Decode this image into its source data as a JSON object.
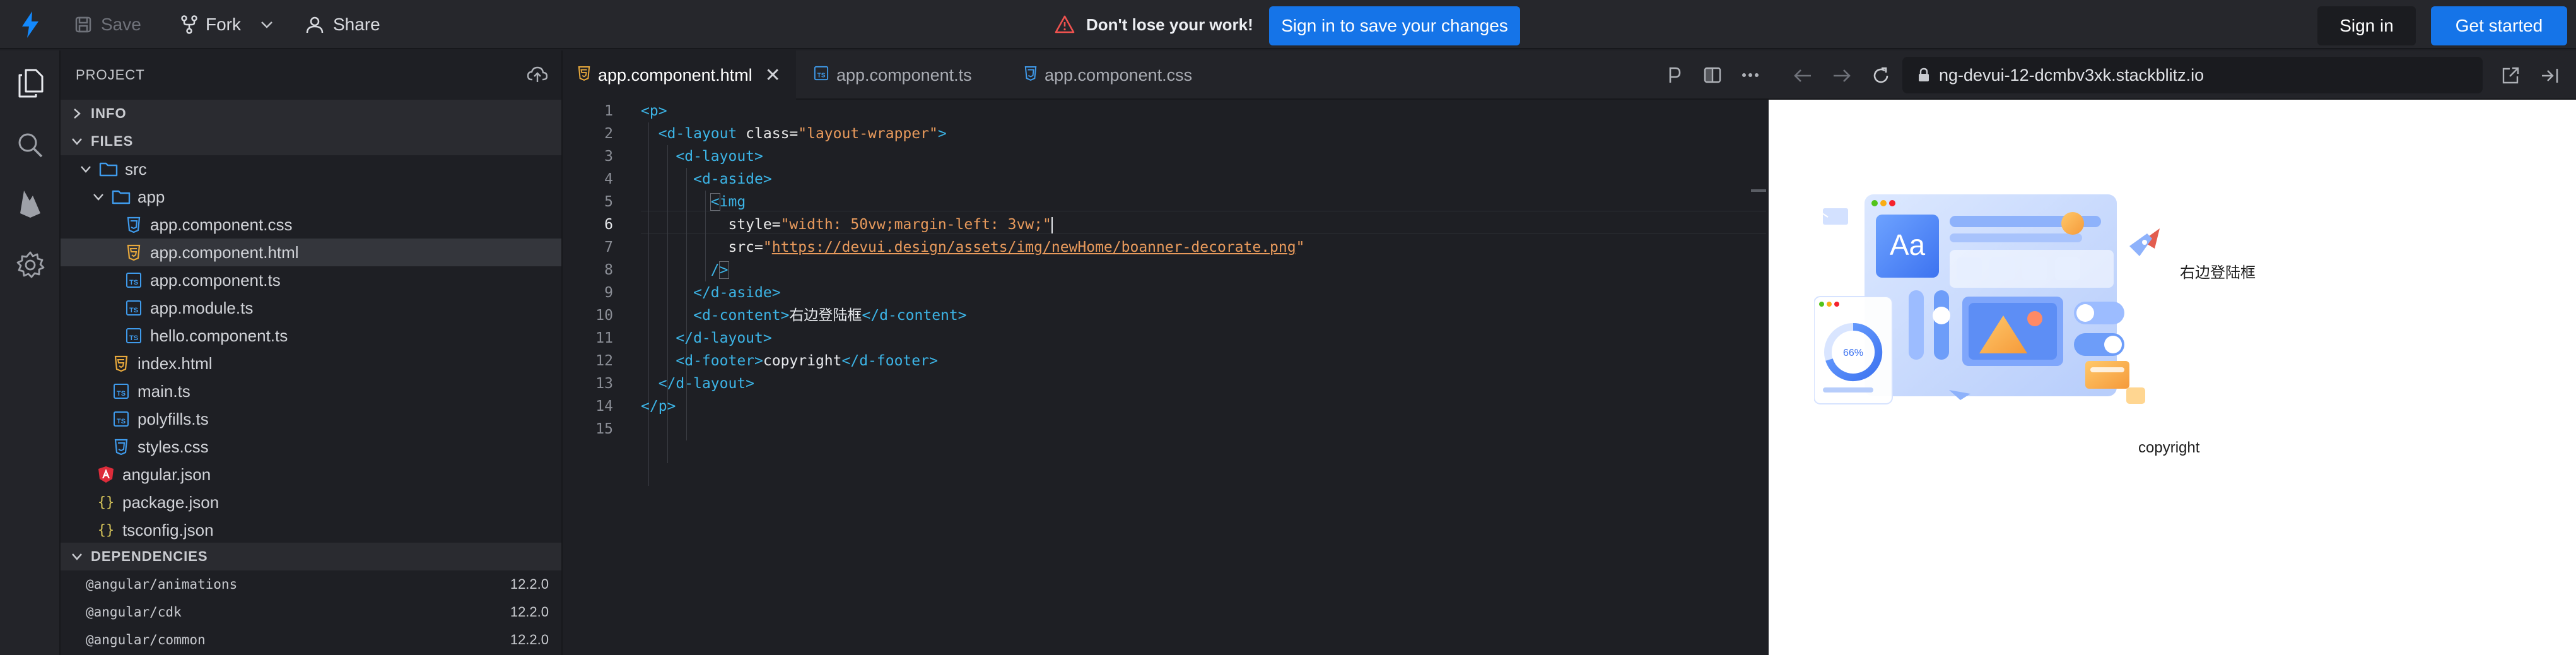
{
  "toolbar": {
    "save_label": "Save",
    "fork_label": "Fork",
    "share_label": "Share",
    "warning_text": "Don't lose your work!",
    "sign_in_save_label": "Sign in to save your changes",
    "sign_in_label": "Sign in",
    "get_started_label": "Get started",
    "accent_color": "#1574e8"
  },
  "sidebar": {
    "header": "PROJECT",
    "sections": {
      "info": "INFO",
      "files": "FILES",
      "dependencies": "DEPENDENCIES"
    },
    "files": [
      {
        "name": "src",
        "type": "folder",
        "icon": "folder-icon"
      },
      {
        "name": "app",
        "type": "folder",
        "icon": "folder-icon"
      },
      {
        "name": "app.component.css",
        "type": "css",
        "icon": "css-file-icon"
      },
      {
        "name": "app.component.html",
        "type": "html",
        "icon": "html-file-icon",
        "selected": true
      },
      {
        "name": "app.component.ts",
        "type": "ts",
        "icon": "ts-file-icon"
      },
      {
        "name": "app.module.ts",
        "type": "ts",
        "icon": "ts-file-icon"
      },
      {
        "name": "hello.component.ts",
        "type": "ts",
        "icon": "ts-file-icon"
      },
      {
        "name": "index.html",
        "type": "html",
        "icon": "html-file-icon"
      },
      {
        "name": "main.ts",
        "type": "ts",
        "icon": "ts-file-icon"
      },
      {
        "name": "polyfills.ts",
        "type": "ts",
        "icon": "ts-file-icon"
      },
      {
        "name": "styles.css",
        "type": "css",
        "icon": "css-file-icon"
      },
      {
        "name": "angular.json",
        "type": "angular",
        "icon": "angular-icon"
      },
      {
        "name": "package.json",
        "type": "json",
        "icon": "json-braces-icon"
      },
      {
        "name": "tsconfig.json",
        "type": "json",
        "icon": "json-braces-icon"
      }
    ],
    "dependencies": [
      {
        "name": "@angular/animations",
        "version": "12.2.0"
      },
      {
        "name": "@angular/cdk",
        "version": "12.2.0"
      },
      {
        "name": "@angular/common",
        "version": "12.2.0"
      }
    ]
  },
  "editor": {
    "tabs": [
      {
        "label": "app.component.html",
        "icon": "html-file-icon",
        "active": true
      },
      {
        "label": "app.component.ts",
        "icon": "ts-file-icon",
        "active": false
      },
      {
        "label": "app.component.css",
        "icon": "css-file-icon",
        "active": false
      }
    ],
    "line_numbers": [
      "1",
      "2",
      "3",
      "4",
      "5",
      "6",
      "7",
      "8",
      "9",
      "10",
      "11",
      "12",
      "13",
      "14",
      "15"
    ],
    "current_line": 6,
    "code": {
      "l1_open": "<p>",
      "l2_tag": "<d-layout",
      "l2_attr": " class=",
      "l2_str": "\"layout-wrapper\"",
      "l2_close": ">",
      "l3": "<d-layout>",
      "l4": "<d-aside>",
      "l5_lt": "<",
      "l5_tag": "img",
      "l6_attr": "style=",
      "l6_str": "\"width: 50vw;margin-left: 3vw;\"",
      "l7_attr": "src=",
      "l7_q1": "\"",
      "l7_url": "https://devui.design/assets/img/newHome/boanner-decorate.png",
      "l7_q2": "\"",
      "l8_slash": "/",
      "l8_gt": ">",
      "l9": "</d-aside>",
      "l10_open": "<d-content>",
      "l10_text": "右边登陆框",
      "l10_close": "</d-content>",
      "l11": "</d-layout>",
      "l12_open": "<d-footer>",
      "l12_text": "copyright",
      "l12_close": "</d-footer>",
      "l13": "</d-layout>",
      "l14": "</p>"
    }
  },
  "preview": {
    "url": "ng-devui-12-dcmbv3xk.stackblitz.io",
    "content_text": "右边登陆框",
    "footer_text": "copyright",
    "illustration": {
      "aa_text": "Aa",
      "gauge_text": "66%"
    }
  }
}
